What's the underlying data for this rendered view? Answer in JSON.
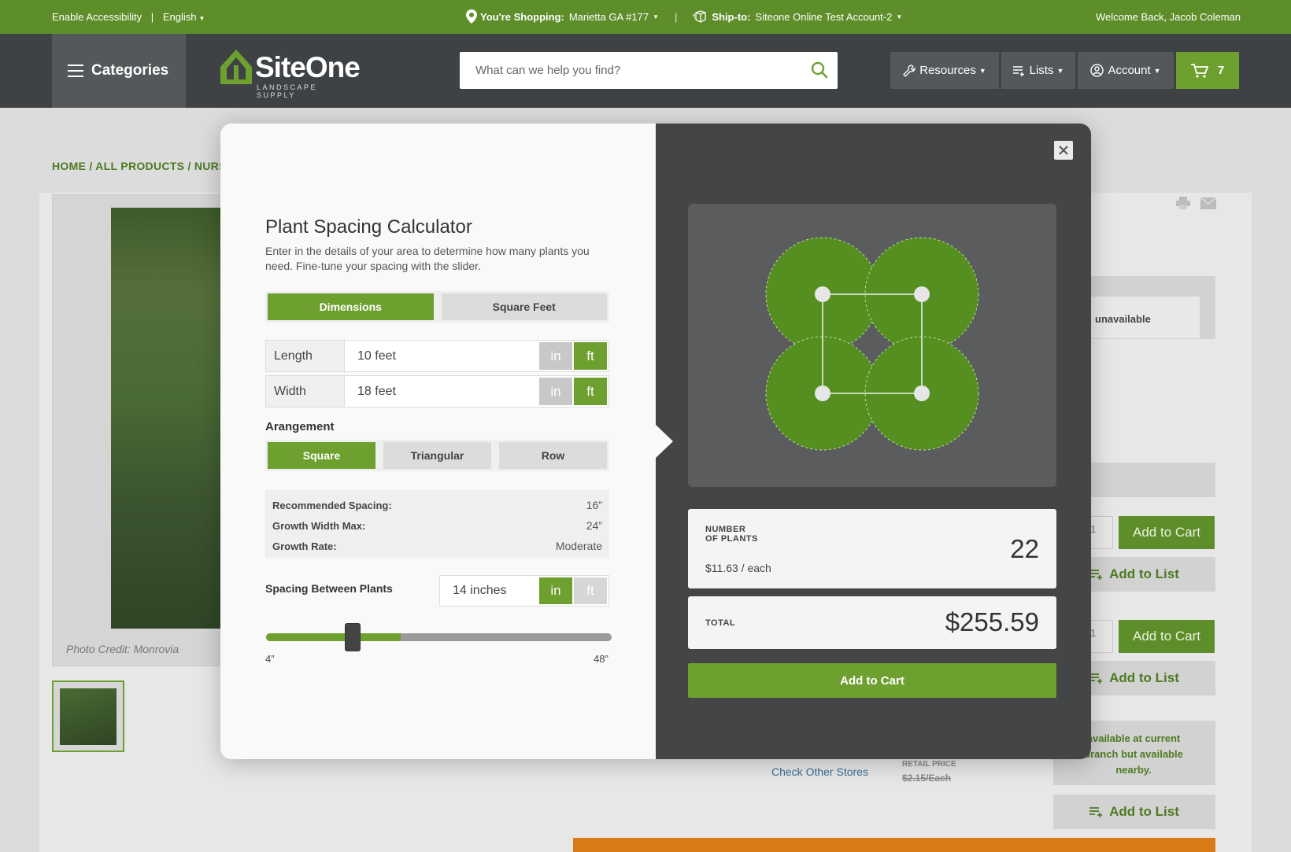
{
  "topbar": {
    "accessibility": "Enable Accessibility",
    "divider": "|",
    "language": "English",
    "shopping_label": "You're Shopping:",
    "shopping_store": "Marietta GA #177",
    "shipto_label": "Ship-to:",
    "shipto_account": "Siteone Online Test Account-2",
    "welcome": "Welcome Back, Jacob Coleman"
  },
  "header": {
    "categories": "Categories",
    "logo_word": "SiteOne",
    "logo_sub": "LANDSCAPE SUPPLY",
    "search_placeholder": "What can we help you find?",
    "nav": {
      "resources": "Resources",
      "lists": "Lists",
      "account": "Account"
    },
    "cart_count": "7"
  },
  "page": {
    "breadcrumb": "HOME / ALL PRODUCTS / NURSER",
    "photo_credit": "Photo Credit: Monrovia",
    "unavailable": "unavailable",
    "add_to_cart": "Add to Cart",
    "add_to_list": "Add to List",
    "qty": "1",
    "check_other_stores": "Check Other Stores",
    "retail_label": "RETAIL PRICE",
    "retail_value": "$2.15/Each",
    "availability_note": "available at current\nbranch but available\nnearby."
  },
  "calculator": {
    "title": "Plant Spacing Calculator",
    "description": "Enter in the details of your area to determine how many plants you need. Fine-tune your spacing with the slider.",
    "modes": [
      "Dimensions",
      "Square Feet"
    ],
    "active_mode": 0,
    "length": {
      "label": "Length",
      "value": "10 feet",
      "unit_in": "in",
      "unit_ft": "ft",
      "active_unit": "ft"
    },
    "width": {
      "label": "Width",
      "value": "18 feet",
      "unit_in": "in",
      "unit_ft": "ft",
      "active_unit": "ft"
    },
    "arrangement_label": "Arangement",
    "arrangements": [
      "Square",
      "Triangular",
      "Row"
    ],
    "active_arrangement": 0,
    "specs": [
      {
        "key": "Recommended Spacing:",
        "value": "16”"
      },
      {
        "key": "Growth Width Max:",
        "value": "24”"
      },
      {
        "key": "Growth Rate:",
        "value": "Moderate"
      }
    ],
    "spacing_label": "Spacing Between Plants",
    "spacing_value": "14 inches",
    "spacing_unit_in": "in",
    "spacing_unit_ft": "ft",
    "slider": {
      "min_label": "4”",
      "max_label": "48”",
      "fill_fraction": 0.39,
      "thumb_fraction": 0.25
    },
    "result": {
      "plants_caption_1": "NUMBER",
      "plants_caption_2": "OF PLANTS",
      "plants_count": "22",
      "price_each": "$11.63 / each",
      "total_caption": "TOTAL",
      "total": "$255.59",
      "add_to_cart": "Add to Cart"
    }
  },
  "colors": {
    "brand_green": "#6ea02f",
    "topbar_green": "#5e8e2a",
    "header_dark": "#3f4244",
    "modal_dark": "#434547"
  }
}
